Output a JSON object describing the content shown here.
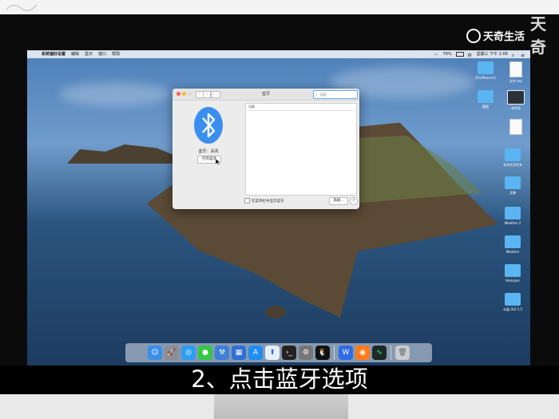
{
  "menubar": {
    "app_name": "系统偏好设置",
    "menus": [
      "编辑",
      "显示",
      "窗口",
      "帮助"
    ],
    "battery": "78%",
    "clock": "星期三 下午 2:06"
  },
  "desktop_icons": [
    {
      "label": "ZOUPhone11"
    },
    {
      "label": "文件.doc"
    },
    {
      "label": "截图"
    },
    {
      "label": "未命名"
    },
    {
      "label": "未命名文件夹"
    },
    {
      "label": "文稿"
    },
    {
      "label": "Weather 2"
    },
    {
      "label": "Weather"
    },
    {
      "label": "Hanojiun"
    },
    {
      "label": "水晶 GUI 1.5"
    }
  ],
  "window": {
    "title": "蓝牙",
    "search_placeholder": "搜索",
    "bt_status": "蓝牙：关闭",
    "bt_toggle": "打开蓝牙",
    "devices_header": "设备",
    "show_in_menubar": "在菜单栏中显示蓝牙",
    "advanced": "高级...",
    "help": "?"
  },
  "caption": "2、点击蓝牙选项",
  "watermark": "天奇生活",
  "corner_brand": "天奇",
  "colors": {
    "accent": "#3a8ef0",
    "close": "#fc5f57",
    "minimize": "#fdbc2e",
    "zoom": "#d8d8d8"
  }
}
